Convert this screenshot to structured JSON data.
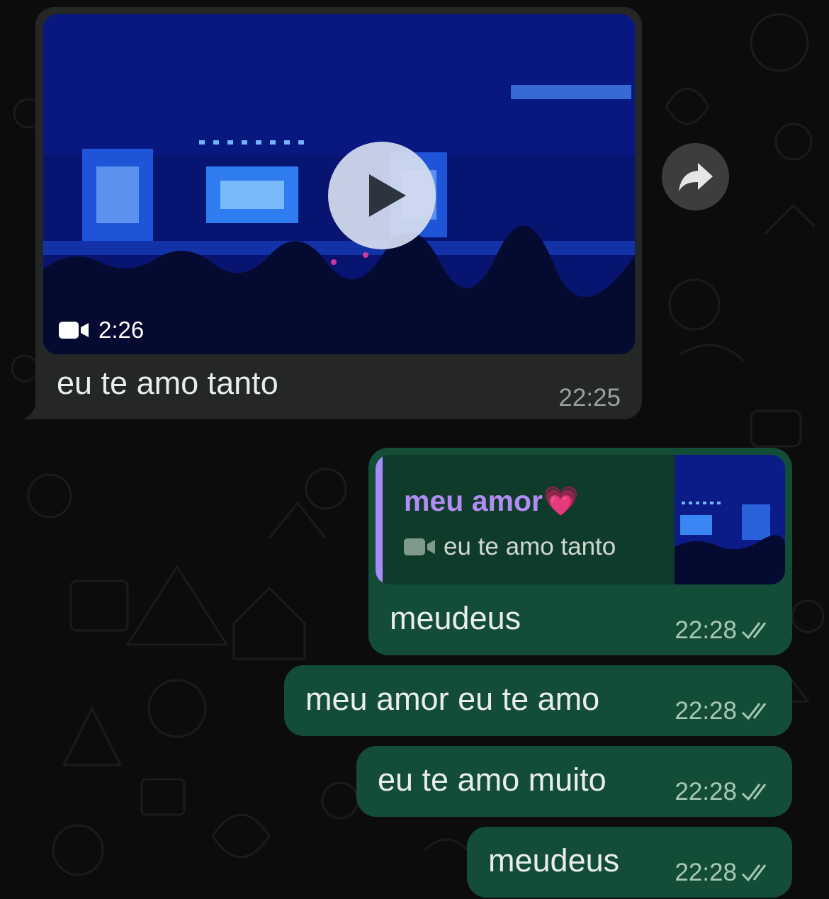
{
  "incoming": {
    "video_duration": "2:26",
    "caption": "eu te amo tanto",
    "time": "22:25",
    "video_icon": "video-camera-icon",
    "play_icon": "play-icon"
  },
  "forward": {
    "icon": "forward-arrow-icon"
  },
  "reply_message": {
    "quoted_name": "meu amor💗",
    "quoted_text": "eu te amo tanto",
    "quoted_icon": "video-camera-icon",
    "text": "meudeus",
    "time": "22:28",
    "status_icon": "double-check-icon"
  },
  "outgoing": [
    {
      "text": "meu amor eu te amo",
      "time": "22:28",
      "status_icon": "double-check-icon"
    },
    {
      "text": "eu te amo muito",
      "time": "22:28",
      "status_icon": "double-check-icon"
    },
    {
      "text": "meudeus",
      "time": "22:28",
      "status_icon": "double-check-icon"
    }
  ],
  "colors": {
    "background": "#0c0c0c",
    "incoming_bubble": "#252626",
    "outgoing_bubble": "#144d37",
    "quote_bar": "#a78bfa",
    "quote_name": "#b18cf4"
  }
}
